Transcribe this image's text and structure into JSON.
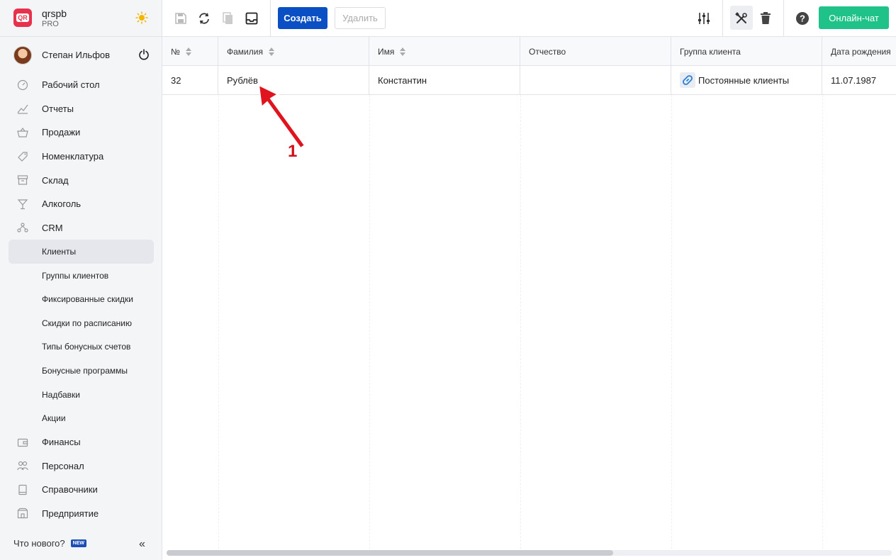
{
  "brand": {
    "name": "qrspb",
    "plan": "PRO",
    "logo_text": "QR"
  },
  "user": {
    "name": "Степан Ильфов"
  },
  "nav": {
    "items": [
      {
        "label": "Рабочий стол",
        "icon": "dashboard-icon"
      },
      {
        "label": "Отчеты",
        "icon": "reports-icon"
      },
      {
        "label": "Продажи",
        "icon": "basket-icon"
      },
      {
        "label": "Номенклатура",
        "icon": "tag-icon"
      },
      {
        "label": "Склад",
        "icon": "warehouse-icon"
      },
      {
        "label": "Алкоголь",
        "icon": "glass-icon"
      },
      {
        "label": "CRM",
        "icon": "crm-icon"
      }
    ],
    "crm_sub": [
      {
        "label": "Клиенты",
        "active": true
      },
      {
        "label": "Группы клиентов"
      },
      {
        "label": "Фиксированные скидки"
      },
      {
        "label": "Скидки по расписанию"
      },
      {
        "label": "Типы бонусных счетов"
      },
      {
        "label": "Бонусные программы"
      },
      {
        "label": "Надбавки"
      },
      {
        "label": "Акции"
      }
    ],
    "bottom_items": [
      {
        "label": "Финансы",
        "icon": "wallet-icon"
      },
      {
        "label": "Персонал",
        "icon": "people-icon"
      },
      {
        "label": "Справочники",
        "icon": "book-icon"
      },
      {
        "label": "Предприятие",
        "icon": "building-icon"
      }
    ],
    "whats_new": "Что нового?",
    "new_badge": "NEW"
  },
  "toolbar": {
    "create_label": "Создать",
    "delete_label": "Удалить",
    "chat_label": "Онлайн-чат"
  },
  "table": {
    "columns": [
      "№",
      "Фамилия",
      "Имя",
      "Отчество",
      "Группа клиента",
      "Дата рождения"
    ],
    "rows": [
      {
        "num": "32",
        "last_name": "Рублёв",
        "first_name": "Константин",
        "middle_name": "",
        "group": "Постоянные клиенты",
        "birth_date": "11.07.1987"
      }
    ]
  },
  "annotation": {
    "label": "1",
    "color": "#d0111b"
  },
  "colors": {
    "primary": "#0b4fc4",
    "chat": "#1fc38a",
    "brand": "#e8324b"
  }
}
